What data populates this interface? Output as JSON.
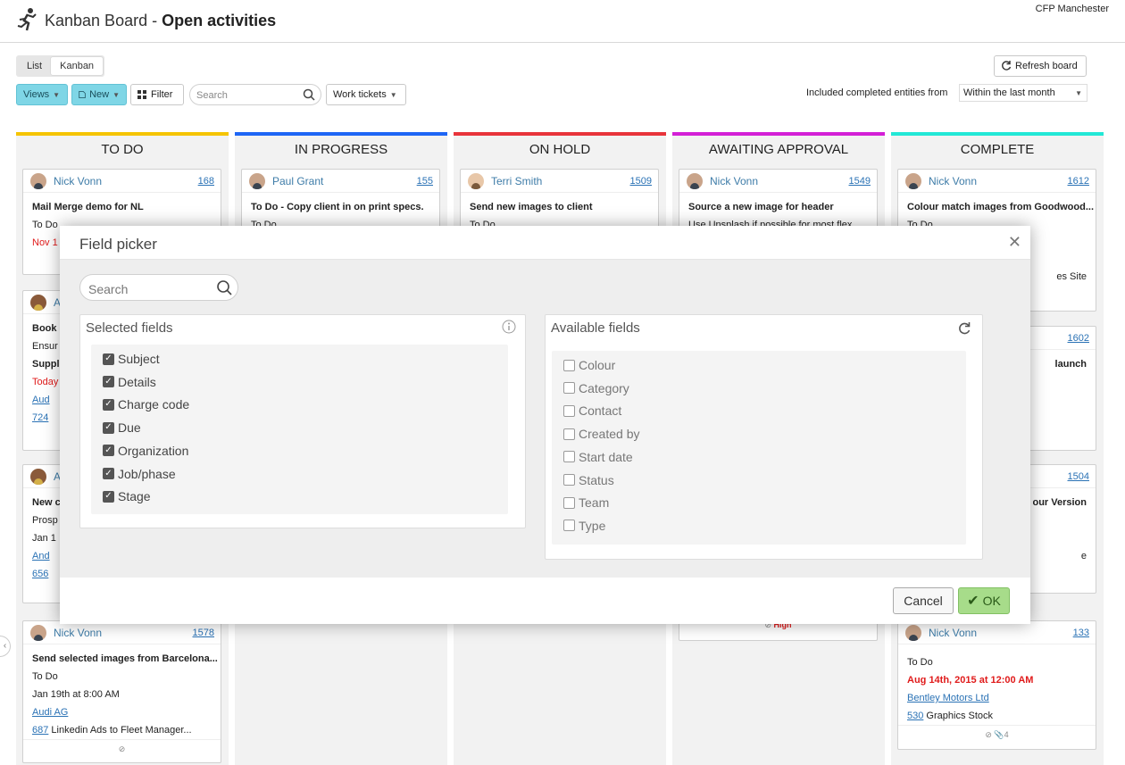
{
  "header": {
    "title_light": "Kanban Board - ",
    "title_bold": "Open activities",
    "org": "CFP Manchester"
  },
  "view_toggle": {
    "list": "List",
    "kanban": "Kanban"
  },
  "toolbar": {
    "views": "Views",
    "new": "New",
    "filter": "Filter",
    "search_placeholder": "Search",
    "work_tickets": "Work tickets",
    "refresh": "Refresh board",
    "included_label": "Included completed entities from",
    "included_value": "Within the last month"
  },
  "columns": [
    {
      "title": "TO DO",
      "color": "#f5c400"
    },
    {
      "title": "IN PROGRESS",
      "color": "#1e66f5"
    },
    {
      "title": "ON HOLD",
      "color": "#e8343b"
    },
    {
      "title": "AWAITING APPROVAL",
      "color": "#d31fd6"
    },
    {
      "title": "COMPLETE",
      "color": "#22e8d6"
    }
  ],
  "cards": {
    "c1": {
      "who": "Nick Vonn",
      "id": "168",
      "subject": "Mail Merge demo for NL",
      "stage": "To Do",
      "due": "Nov 1"
    },
    "c2": {
      "who": "Paul Grant",
      "id": "155",
      "subject": "To Do - Copy client in on print specs.",
      "stage": "To Do"
    },
    "c3": {
      "who": "Terri Smith",
      "id": "1509",
      "subject": "Send new images to client",
      "stage": "To Do"
    },
    "c4": {
      "who": "Nick Vonn",
      "id": "1549",
      "subject": "Source a new image for header",
      "stage": "Use Unsplash if possible for most flex"
    },
    "c5": {
      "who": "Nick Vonn",
      "id": "1612",
      "subject": "Colour match images from Goodwood...",
      "stage": "To Do",
      "job": "es Site"
    },
    "c6": {
      "who": "A",
      "subject": "Book c",
      "details": "Ensur",
      "charge": "Suppli",
      "due": "Today",
      "org": "Aud",
      "job": "724"
    },
    "c7": {
      "id": "1602",
      "subject": "launch"
    },
    "c8": {
      "who": "A",
      "subject": "New c",
      "details": "Prosp",
      "due": "Jan 1",
      "org": "And",
      "job": "656"
    },
    "c9": {
      "id": "1504",
      "subject": "our Version",
      "job": "e"
    },
    "c10": {
      "who": "Nick Vonn",
      "id": "1578",
      "subject": "Send selected images from Barcelona...",
      "stage": "To Do",
      "due": "Jan 19th at 8:00 AM",
      "org": "Audi AG",
      "job_no": "687",
      "job": "Linkedin Ads to Fleet Manager..."
    },
    "c11": {
      "priority": "High"
    },
    "c12": {
      "who": "Nick Vonn",
      "id": "133",
      "stage": "To Do",
      "due": "Aug 14th, 2015 at 12:00 AM",
      "org": "Bentley Motors Ltd",
      "job_no": "530",
      "job": "Graphics Stock",
      "attach": "4"
    }
  },
  "dialog": {
    "title": "Field picker",
    "search_placeholder": "Search",
    "selected_title": "Selected fields",
    "available_title": "Available fields",
    "selected": [
      "Subject",
      "Details",
      "Charge code",
      "Due",
      "Organization",
      "Job/phase",
      "Stage"
    ],
    "available": [
      "Colour",
      "Category",
      "Contact",
      "Created by",
      "Start date",
      "Status",
      "Team",
      "Type"
    ],
    "cancel": "Cancel",
    "ok": "OK"
  }
}
